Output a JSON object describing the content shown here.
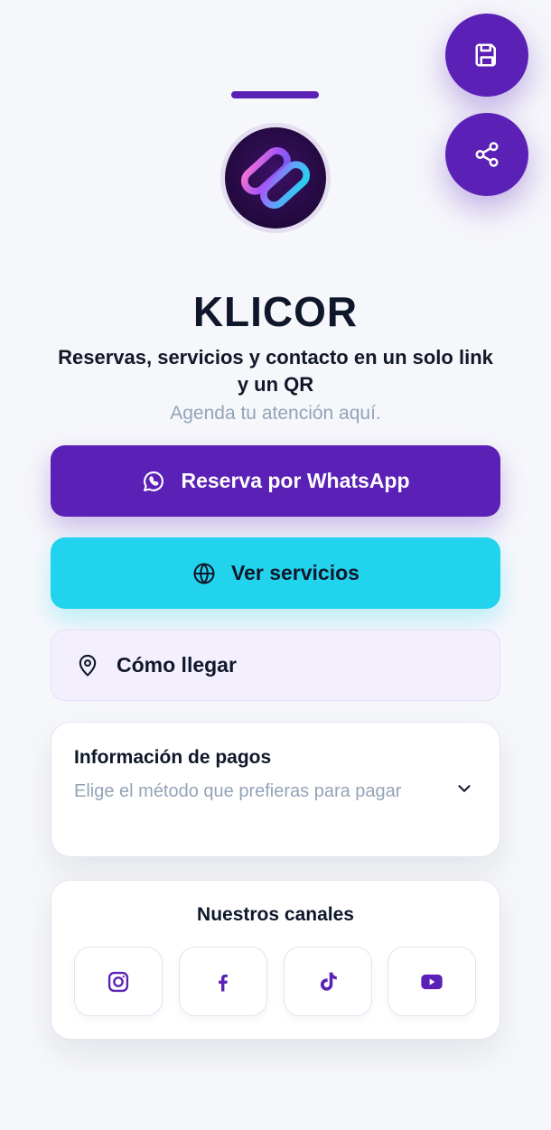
{
  "brand": {
    "title": "KLICOR",
    "subtitle": "Reservas, servicios y contacto en un solo link y un QR",
    "tagline": "Agenda tu atención aquí."
  },
  "actions": {
    "whatsapp_label": "Reserva por WhatsApp",
    "services_label": "Ver servicios",
    "directions_label": "Cómo llegar"
  },
  "payments": {
    "title": "Información de pagos",
    "description": "Elige el método que prefieras para pagar"
  },
  "channels": {
    "title": "Nuestros canales",
    "items": [
      {
        "icon": "instagram-icon"
      },
      {
        "icon": "facebook-icon"
      },
      {
        "icon": "tiktok-icon"
      },
      {
        "icon": "youtube-icon"
      }
    ]
  },
  "fab": {
    "save_icon": "save-icon",
    "share_icon": "share-icon"
  },
  "colors": {
    "primary": "#5b21b6",
    "accent": "#22d3ee",
    "soft": "#f3effc",
    "background": "#f6f7fb",
    "muted_text": "#94a3b8"
  }
}
